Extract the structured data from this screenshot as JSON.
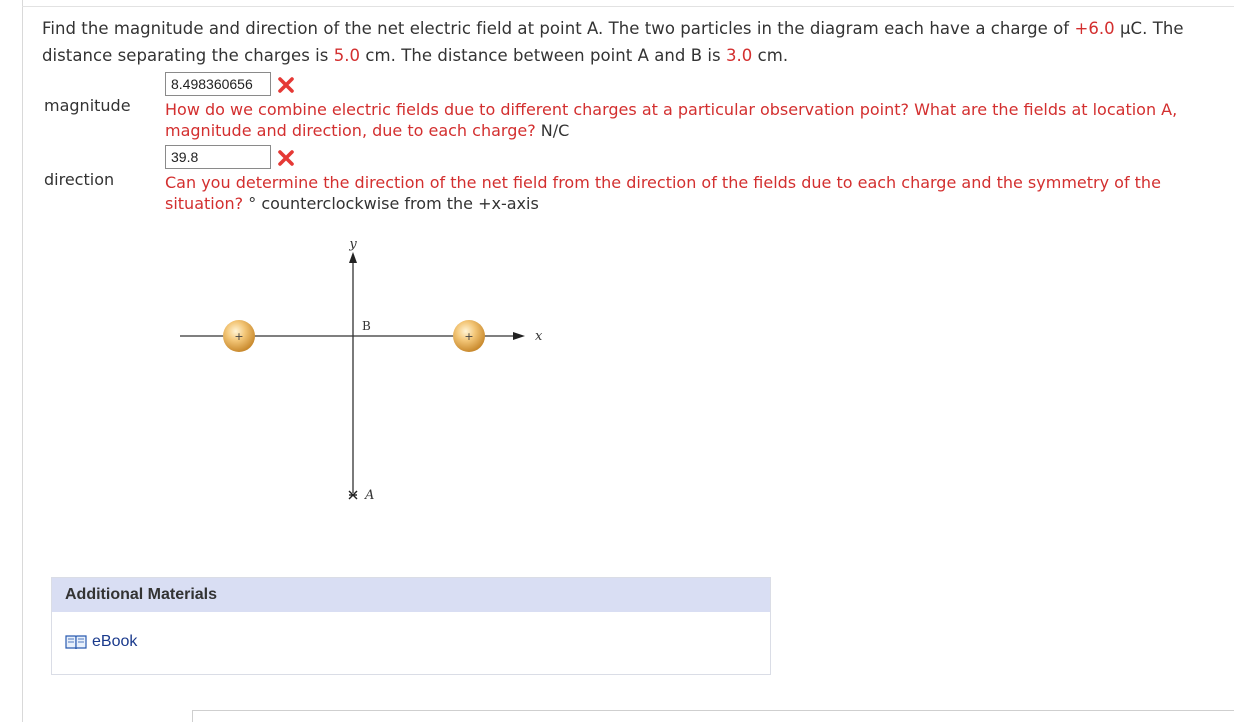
{
  "question": {
    "part1": "Find the magnitude and direction of the net electric field at point A. The two particles in the diagram each have a charge of ",
    "charge": "+6.0",
    "part2": " μC. The distance separating the charges is ",
    "separation": "5.0",
    "part3": " cm. The distance between point A and B is ",
    "ab_distance": "3.0",
    "part4": " cm."
  },
  "magnitude": {
    "label": "magnitude",
    "value": "8.498360656",
    "hint_red": "How do we combine electric fields due to different charges at a particular observation point? What are the fields at location A, magnitude and direction, due to each charge?",
    "unit": " N/C"
  },
  "direction": {
    "label": "direction",
    "value": "39.8",
    "hint_red": "Can you determine the direction of the net field from the direction of the fields due to each charge and the symmetry of the situation?",
    "unit": " ° counterclockwise from the +x-axis"
  },
  "diagram": {
    "y_label": "y",
    "x_label": "x",
    "b_label": "B",
    "a_label": "A",
    "charge_sign": "+"
  },
  "colors": {
    "error": "#d32f2f",
    "panel_head": "#d9def3",
    "link": "#1a3a8c"
  },
  "additional": {
    "title": "Additional Materials",
    "ebook_label": "eBook",
    "ebook_icon": "book-icon"
  }
}
